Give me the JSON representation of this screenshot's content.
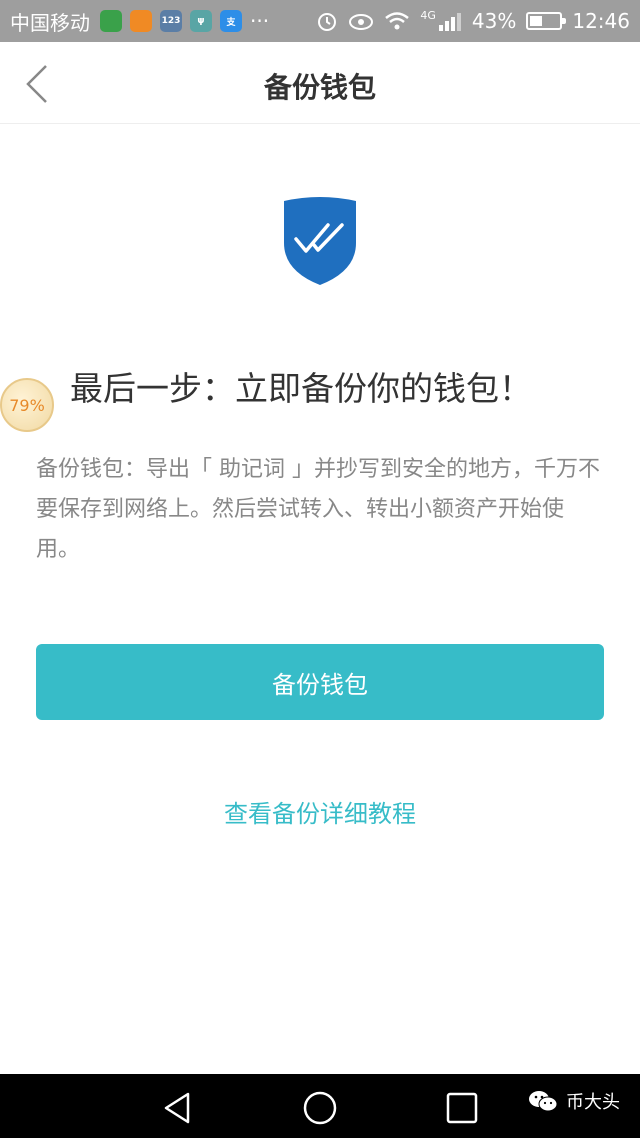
{
  "status_bar": {
    "carrier": "中国移动",
    "app_icons": [
      {
        "icon": "green-circle-app-icon",
        "color": "#3aa14a",
        "label": ""
      },
      {
        "icon": "orange-leaf-app-icon",
        "color": "#f08a24",
        "label": ""
      },
      {
        "icon": "blue-app-icon",
        "color": "#5b7ea6",
        "label": "123"
      },
      {
        "icon": "usb-icon",
        "color": "#59a5a5",
        "label": "ψ"
      },
      {
        "icon": "alipay-icon",
        "color": "#2d8ee8",
        "label": "支"
      }
    ],
    "more": "···",
    "network": "4G",
    "battery_percent": "43%",
    "battery_level": 0.43,
    "time": "12:46"
  },
  "header": {
    "title": "备份钱包"
  },
  "content": {
    "heading": "最后一步：立即备份你的钱包！",
    "badge": "79%",
    "description": "备份钱包：导出「 助记词 」并抄写到安全的地方，千万不要保存到网络上。然后尝试转入、转出小额资产开始使用。",
    "primary_button": "备份钱包",
    "tutorial_link": "查看备份详细教程"
  },
  "watermark": {
    "text": "币大头"
  },
  "colors": {
    "accent": "#37bcc8",
    "shield": "#1f6fbf"
  }
}
